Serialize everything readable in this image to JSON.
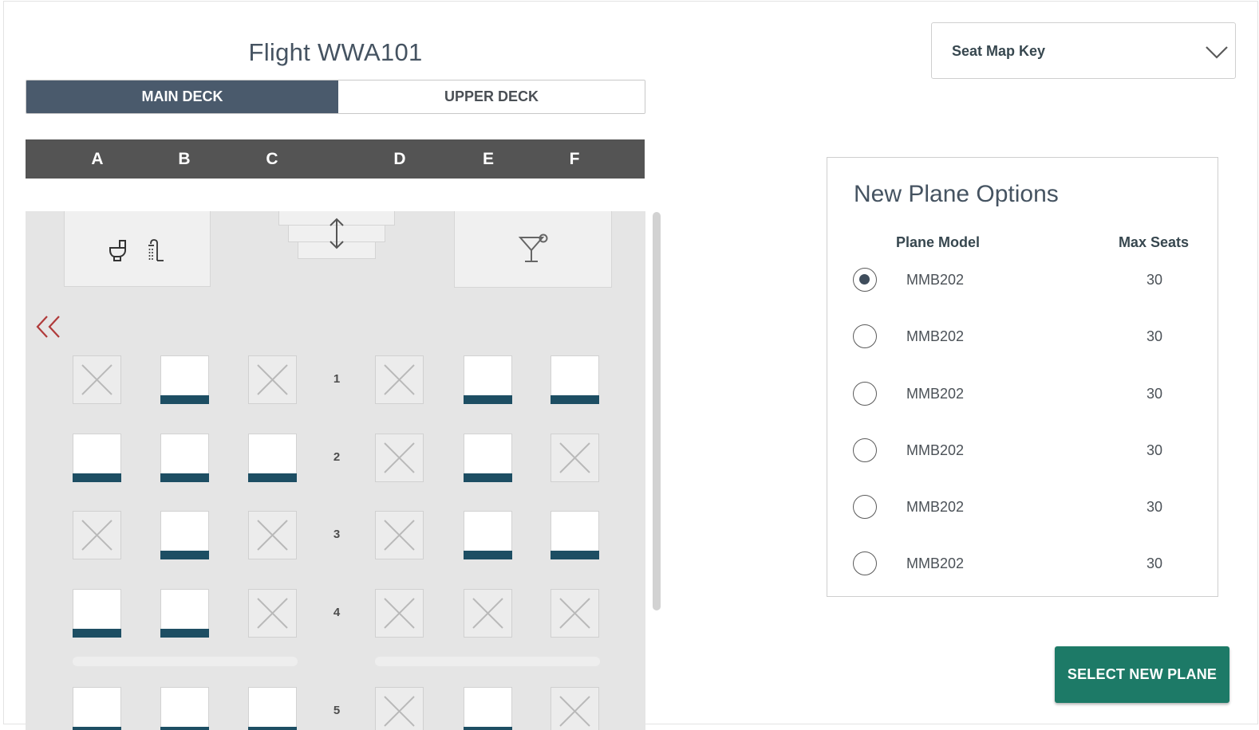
{
  "flight": {
    "title": "Flight WWA101"
  },
  "deck_tabs": {
    "main": "MAIN DECK",
    "upper": "UPPER DECK",
    "active": "main"
  },
  "seat_columns": [
    "A",
    "B",
    "C",
    "D",
    "E",
    "F"
  ],
  "facilities": {
    "lavatory_icons": [
      "toilet-icon",
      "shower-icon"
    ],
    "stairs_icon": "up-down-arrow-icon",
    "bar_icon": "cocktail-icon"
  },
  "seat_rows": [
    {
      "row": "1",
      "seats": [
        "unavailable",
        "available",
        "unavailable",
        "unavailable",
        "available",
        "available"
      ]
    },
    {
      "row": "2",
      "seats": [
        "available",
        "available",
        "available",
        "unavailable",
        "available",
        "unavailable"
      ]
    },
    {
      "row": "3",
      "seats": [
        "unavailable",
        "available",
        "unavailable",
        "unavailable",
        "available",
        "available"
      ]
    },
    {
      "row": "4",
      "seats": [
        "available",
        "available",
        "unavailable",
        "unavailable",
        "unavailable",
        "unavailable"
      ]
    },
    {
      "row": "5",
      "seats": [
        "available",
        "available",
        "available",
        "unavailable",
        "available",
        "unavailable"
      ]
    }
  ],
  "seat_key": {
    "label": "Seat Map Key",
    "icon": "chevron-down-icon"
  },
  "plane_options": {
    "title": "New Plane Options",
    "col_model": "Plane Model",
    "col_max": "Max Seats",
    "rows": [
      {
        "model": "MMB202",
        "max_seats": "30",
        "selected": true
      },
      {
        "model": "MMB202",
        "max_seats": "30",
        "selected": false
      },
      {
        "model": "MMB202",
        "max_seats": "30",
        "selected": false
      },
      {
        "model": "MMB202",
        "max_seats": "30",
        "selected": false
      },
      {
        "model": "MMB202",
        "max_seats": "30",
        "selected": false
      },
      {
        "model": "MMB202",
        "max_seats": "30",
        "selected": false
      }
    ]
  },
  "select_button": {
    "label": "SELECT NEW PLANE"
  },
  "colors": {
    "tab_active": "#4a5a6c",
    "header_bar": "#545454",
    "seat_bar": "#1d4e63",
    "primary_button": "#1d7a67",
    "collapse_icon": "#b03a3a"
  }
}
